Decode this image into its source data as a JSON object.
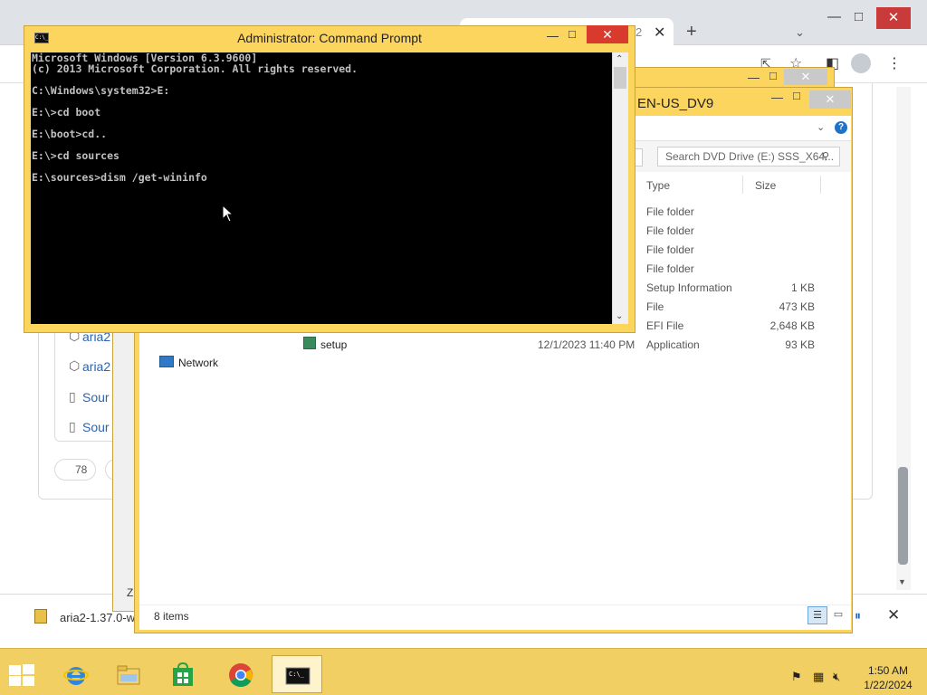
{
  "chrome": {
    "tab_fragment": "2",
    "download_filename": "aria2-1.37.0-w",
    "reaction_count": "78",
    "source_links": [
      {
        "label": "aria2",
        "icon": "package-icon"
      },
      {
        "label": "aria2",
        "icon": "package-icon"
      },
      {
        "label": "Sour",
        "icon": "zip-icon"
      },
      {
        "label": "Sour",
        "icon": "zip-icon"
      }
    ]
  },
  "explorer": {
    "title_fragment": "EN-US_DV9",
    "search_placeholder": "Search DVD Drive (E:) SSS_X64...",
    "columns": {
      "type": "Type",
      "size": "Size"
    },
    "rows": [
      {
        "type": "File folder",
        "size": ""
      },
      {
        "type": "File folder",
        "size": ""
      },
      {
        "type": "File folder",
        "size": ""
      },
      {
        "type": "File folder",
        "size": ""
      },
      {
        "type": "Setup Information",
        "size": "1 KB"
      },
      {
        "type": "File",
        "size": "473 KB"
      },
      {
        "type": "EFI File",
        "size": "2,648 KB"
      }
    ],
    "setup_row": {
      "name": "setup",
      "date": "12/1/2023 11:40 PM",
      "type": "Application",
      "size": "93 KB"
    },
    "nav_network": "Network",
    "status_items": "8 items",
    "back_window_fragment": "Z"
  },
  "cmd": {
    "title": "Administrator: Command Prompt",
    "icon_text": "C:\\_",
    "lines": "Microsoft Windows [Version 6.3.9600]\n(c) 2013 Microsoft Corporation. All rights reserved.\n\nC:\\Windows\\system32>E:\n\nE:\\>cd boot\n\nE:\\boot>cd..\n\nE:\\>cd sources\n\nE:\\sources>dism /get-wininfo"
  },
  "taskbar": {
    "apps": [
      {
        "name": "Internet Explorer",
        "icon": "ie-icon"
      },
      {
        "name": "File Explorer",
        "icon": "folder-icon"
      },
      {
        "name": "Store",
        "icon": "store-icon"
      },
      {
        "name": "Google Chrome",
        "icon": "chrome-icon"
      },
      {
        "name": "Command Prompt",
        "icon": "cmd-icon"
      }
    ],
    "tray": {
      "time": "1:50 AM",
      "date": "1/22/2024"
    }
  },
  "colors": {
    "window_frame": "#fbd55e",
    "desktop": "#f0b400",
    "close_red": "#d83a2e",
    "console_bg": "#000000",
    "console_text": "#c0c0c0"
  }
}
